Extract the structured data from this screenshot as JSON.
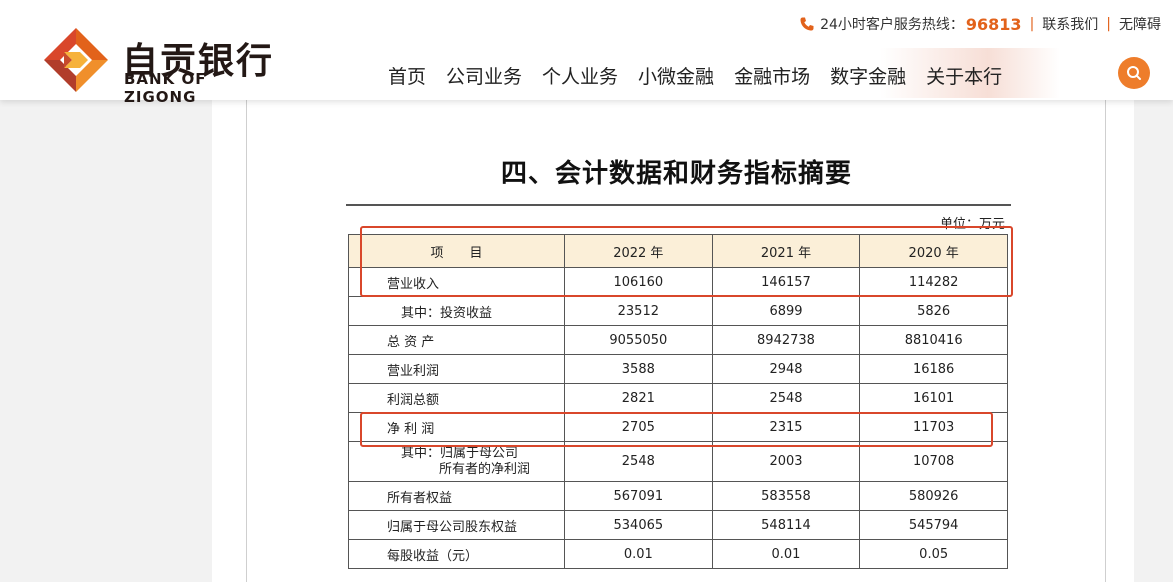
{
  "brand": {
    "name_cn": "自贡银行",
    "name_en": "BANK OF ZIGONG",
    "colors": {
      "orange": "#ee7d2b",
      "red": "#d9472b",
      "dark_red": "#a63a2a"
    }
  },
  "topbar": {
    "hotline_label": "24小时客户服务热线：",
    "hotline_number": "96813",
    "contact": "联系我们",
    "accessibility": "无障碍"
  },
  "nav": {
    "items": [
      "首页",
      "公司业务",
      "个人业务",
      "小微金融",
      "金融市场",
      "数字金融",
      "关于本行"
    ]
  },
  "document": {
    "title": "四、会计数据和财务指标摘要",
    "unit": "单位：万元",
    "headers": [
      "项　　目",
      "2022 年",
      "2021 年",
      "2020 年"
    ],
    "rows": [
      {
        "label": "营业收入",
        "values": [
          "106160",
          "146157",
          "114282"
        ]
      },
      {
        "label": "其中：投资收益",
        "values": [
          "23512",
          "6899",
          "5826"
        ]
      },
      {
        "label": "总 资 产",
        "values": [
          "9055050",
          "8942738",
          "8810416"
        ]
      },
      {
        "label": "营业利润",
        "values": [
          "3588",
          "2948",
          "16186"
        ]
      },
      {
        "label": "利润总额",
        "values": [
          "2821",
          "2548",
          "16101"
        ]
      },
      {
        "label": "净  利  润",
        "values": [
          "2705",
          "2315",
          "11703"
        ]
      },
      {
        "label": "其中：归属于母公司",
        "label2": "所有者的净利润",
        "values": [
          "2548",
          "2003",
          "10708"
        ]
      },
      {
        "label": "所有者权益",
        "values": [
          "567091",
          "583558",
          "580926"
        ]
      },
      {
        "label": "归属于母公司股东权益",
        "values": [
          "534065",
          "548114",
          "545794"
        ]
      },
      {
        "label": "每股收益（元）",
        "values": [
          "0.01",
          "0.01",
          "0.05"
        ]
      }
    ]
  },
  "icons": [
    "logo-mark-icon",
    "phone-icon",
    "search-icon"
  ]
}
